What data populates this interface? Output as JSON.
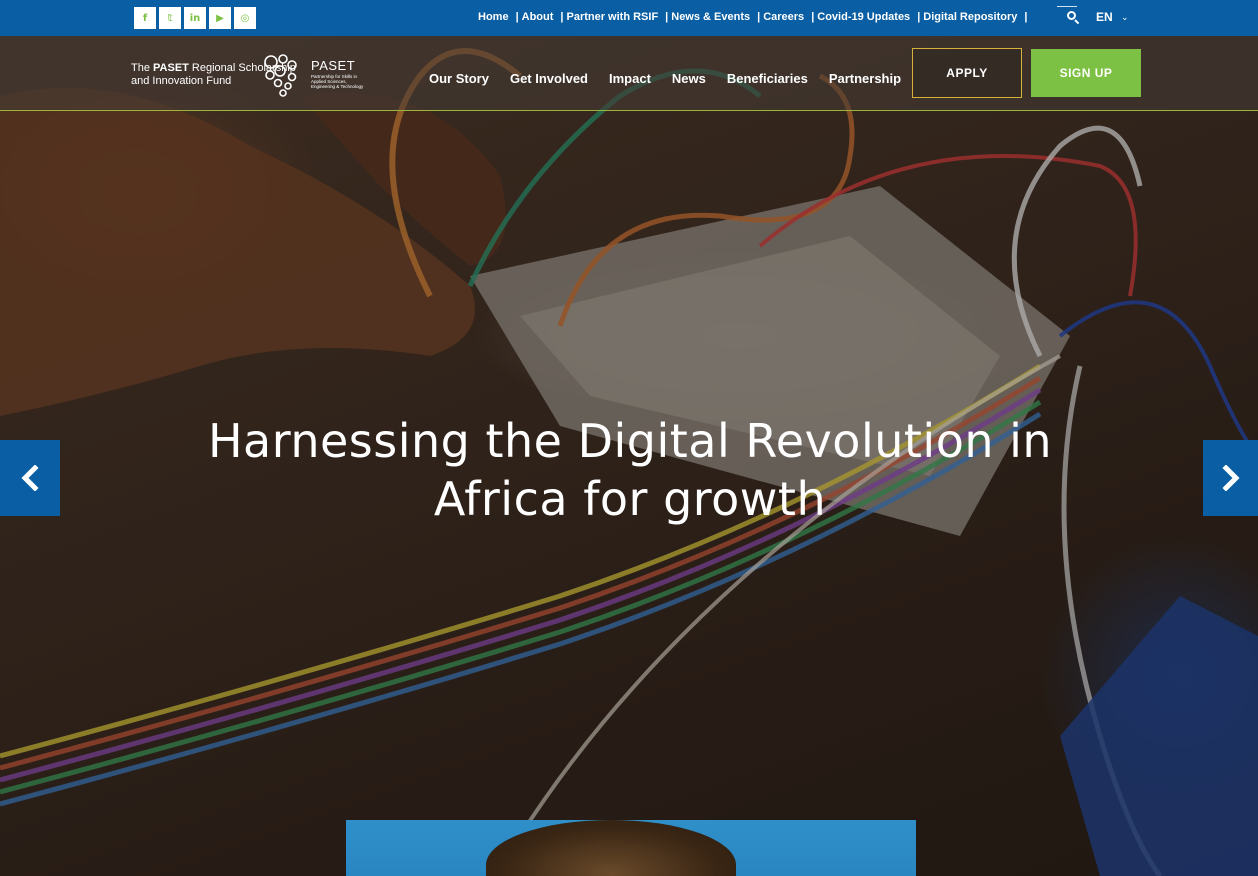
{
  "social": [
    {
      "name": "facebook-icon",
      "glyph": "f"
    },
    {
      "name": "twitter-icon",
      "glyph": "𝕥"
    },
    {
      "name": "linkedin-icon",
      "glyph": "in"
    },
    {
      "name": "youtube-icon",
      "glyph": "▶"
    },
    {
      "name": "instagram-icon",
      "glyph": "◎"
    }
  ],
  "topnav": [
    {
      "label": "Home"
    },
    {
      "label": "About"
    },
    {
      "label": "Partner with RSIF"
    },
    {
      "label": "News & Events"
    },
    {
      "label": "Careers"
    },
    {
      "label": "Covid-19 Updates"
    },
    {
      "label": "Digital Repository"
    }
  ],
  "language": {
    "selected": "EN"
  },
  "logo": {
    "line1_bold": "PASET",
    "line1_pre": "The ",
    "line1_post": " Regional Scholarship",
    "line2": "and Innovation Fund",
    "paset_title": "PASET",
    "paset_sub": "Partnership for Skills in Applied Sciences, Engineering & Technology"
  },
  "mainnav": [
    {
      "label": "Our Story"
    },
    {
      "label": "Get Involved"
    },
    {
      "label": "Impact"
    },
    {
      "label": "News"
    },
    {
      "label": "Beneficiaries"
    },
    {
      "label": "Partnership"
    }
  ],
  "buttons": {
    "apply": "APPLY",
    "signup": "SIGN UP"
  },
  "hero": {
    "headline_line1": "Harnessing the Digital Revolution in",
    "headline_line2": "Africa for growth"
  },
  "colors": {
    "brand_blue": "#0a5ea3",
    "brand_green": "#7cc144",
    "apply_border": "#d6b23c"
  }
}
